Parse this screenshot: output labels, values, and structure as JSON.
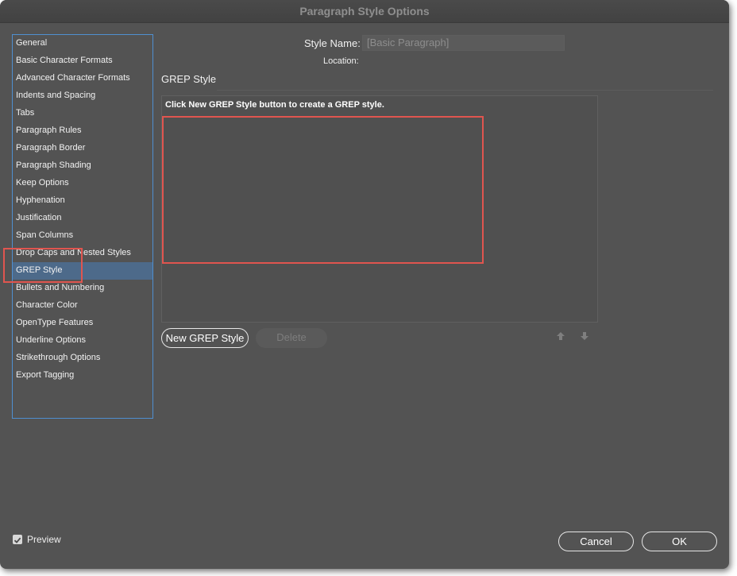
{
  "window": {
    "title": "Paragraph Style Options"
  },
  "sidebar": {
    "items": [
      {
        "label": "General"
      },
      {
        "label": "Basic Character Formats"
      },
      {
        "label": "Advanced Character Formats"
      },
      {
        "label": "Indents and Spacing"
      },
      {
        "label": "Tabs"
      },
      {
        "label": "Paragraph Rules"
      },
      {
        "label": "Paragraph Border"
      },
      {
        "label": "Paragraph Shading"
      },
      {
        "label": "Keep Options"
      },
      {
        "label": "Hyphenation"
      },
      {
        "label": "Justification"
      },
      {
        "label": "Span Columns"
      },
      {
        "label": "Drop Caps and Nested Styles"
      },
      {
        "label": "GREP Style"
      },
      {
        "label": "Bullets and Numbering"
      },
      {
        "label": "Character Color"
      },
      {
        "label": "OpenType Features"
      },
      {
        "label": "Underline Options"
      },
      {
        "label": "Strikethrough Options"
      },
      {
        "label": "Export Tagging"
      }
    ],
    "selected": "GREP Style"
  },
  "header": {
    "style_name_label": "Style Name:",
    "style_name_value": "[Basic Paragraph]",
    "location_label": "Location:"
  },
  "section": {
    "title": "GREP Style",
    "hint": "Click New GREP Style button to create a GREP style.",
    "new_button": "New GREP Style",
    "delete_button": "Delete",
    "move_up_icon": "arrow-up-icon",
    "move_down_icon": "arrow-down-icon"
  },
  "footer": {
    "preview_label": "Preview",
    "preview_checked": true,
    "cancel_button": "Cancel",
    "ok_button": "OK"
  },
  "colors": {
    "dialog_bg": "#535353",
    "accent_border": "#4f8fd0",
    "selection_bg": "#4d6a8a",
    "annotation_red": "#e0554f"
  }
}
